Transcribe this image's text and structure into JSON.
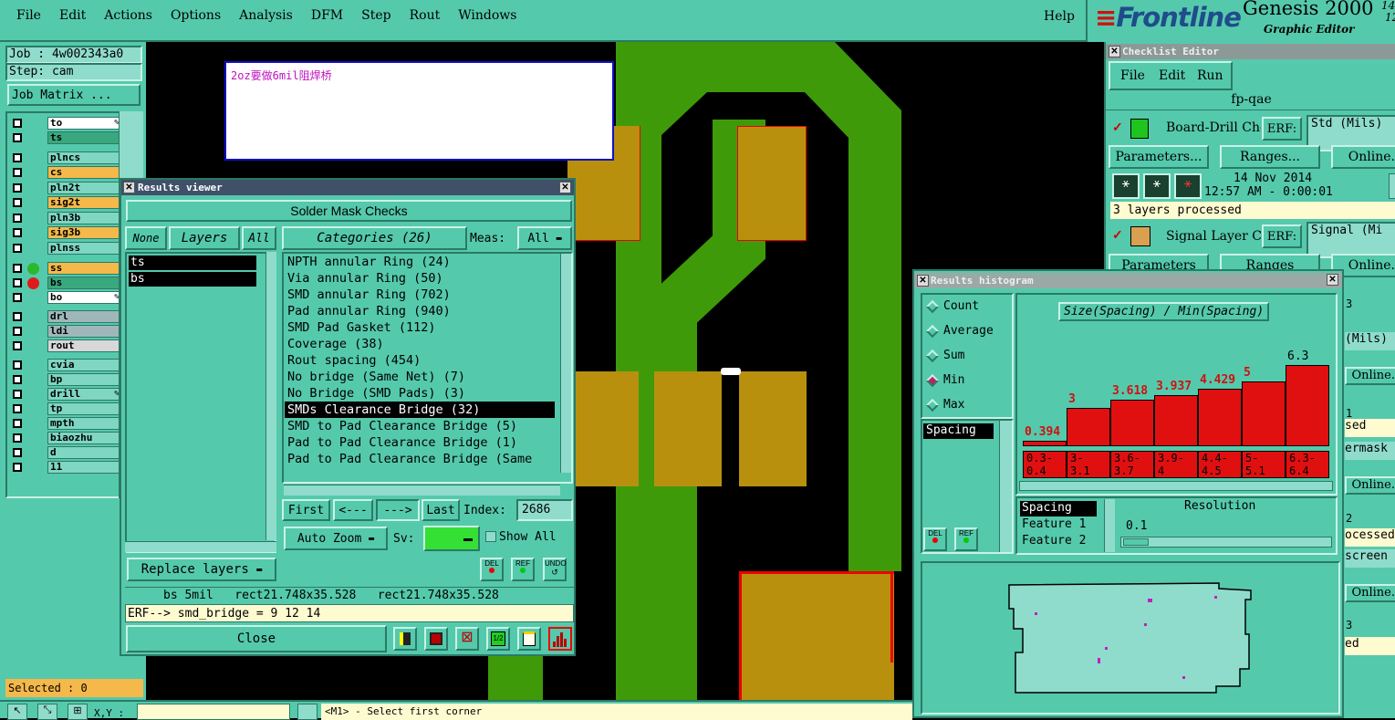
{
  "menubar": {
    "items": [
      "File",
      "Edit",
      "Actions",
      "Options",
      "Analysis",
      "DFM",
      "Step",
      "Rout",
      "Windows"
    ],
    "help": "Help"
  },
  "brand": {
    "logo": "Frontline",
    "product": "Genesis 2000",
    "subtitle": "Graphic Editor",
    "corner_top": "14",
    "corner_bottom": "12"
  },
  "left_panel": {
    "job": "Job : 4w002343a0",
    "step": "Step: cam",
    "job_matrix": "Job Matrix ...",
    "selected": "Selected : 0",
    "layers": [
      {
        "name": "to",
        "color": "#ffffff",
        "mark": true
      },
      {
        "name": "ts",
        "color": "#3aa87e",
        "mark": false
      },
      {
        "name": "plncs",
        "color": "#7fd6c2",
        "mark": false
      },
      {
        "name": "cs",
        "color": "#f5b84a",
        "mark": false
      },
      {
        "name": "pln2t",
        "color": "#7fd6c2",
        "mark": false
      },
      {
        "name": "sig2t",
        "color": "#f5b84a",
        "mark": false
      },
      {
        "name": "pln3b",
        "color": "#7fd6c2",
        "mark": false
      },
      {
        "name": "sig3b",
        "color": "#f5b84a",
        "mark": false
      },
      {
        "name": "plnss",
        "color": "#7fd6c2",
        "mark": false
      },
      {
        "name": "ss",
        "color": "#f5b84a",
        "mark": false
      },
      {
        "name": "bs",
        "color": "#3aa87e",
        "mark": false
      },
      {
        "name": "bo",
        "color": "#ffffff",
        "mark": true
      },
      {
        "name": "drl",
        "color": "#9fb7bb",
        "mark": false
      },
      {
        "name": "ldi",
        "color": "#9fb7bb",
        "mark": false
      },
      {
        "name": "rout",
        "color": "#d8d8d8",
        "mark": false
      },
      {
        "name": "cvia",
        "color": "#7fd6c2",
        "mark": false
      },
      {
        "name": "bp",
        "color": "#7fd6c2",
        "mark": false
      },
      {
        "name": "drill",
        "color": "#7fd6c2",
        "mark": true
      },
      {
        "name": "tp",
        "color": "#7fd6c2",
        "mark": false
      },
      {
        "name": "mpth",
        "color": "#7fd6c2",
        "mark": false
      },
      {
        "name": "biaozhu",
        "color": "#7fd6c2",
        "mark": false
      },
      {
        "name": "d",
        "color": "#7fd6c2",
        "mark": false
      },
      {
        "name": "11",
        "color": "#7fd6c2",
        "mark": false
      }
    ]
  },
  "note": {
    "text": "2oz要做6mil阻焊桥"
  },
  "results_viewer": {
    "title": "Results viewer",
    "heading": "Solder Mask Checks",
    "none": "None",
    "layers_label": "Layers",
    "all": "All",
    "categories_label": "Categories (26)",
    "meas_label": "Meas:",
    "meas_value": "All",
    "layer_list": [
      "ts",
      "bs"
    ],
    "categories": [
      "NPTH annular Ring (24)",
      "Via annular Ring (50)",
      "SMD annular Ring (702)",
      "Pad annular Ring (940)",
      "SMD Pad Gasket (112)",
      "Coverage (38)",
      "Rout spacing (454)",
      "No bridge (Same Net) (7)",
      "No Bridge (SMD Pads) (3)",
      "SMDs Clearance Bridge (32)",
      "SMD to Pad Clearance Bridge (5)",
      "Pad to Pad Clearance Bridge (1)",
      "Pad to Pad Clearance Bridge (Same"
    ],
    "selected_category": "SMDs Clearance Bridge (32)",
    "first": "First",
    "prev": "<---",
    "next": "--->",
    "last": "Last",
    "index_label": "Index:",
    "index_value": "2686",
    "auto_zoom": "Auto Zoom",
    "sv_label": "Sv:",
    "show_all": "Show All",
    "replace_layers": "Replace layers",
    "del": "DEL",
    "ref": "REF",
    "undo": "UNDO",
    "status": "bs 5mil   rect21.748x35.528   rect21.748x35.528",
    "erf": "ERF--> smd_bridge = 9 12 14",
    "close": "Close"
  },
  "checklist": {
    "title": "Checklist Editor",
    "menu": [
      "File",
      "Edit",
      "Run"
    ],
    "name": "fp-qae",
    "row1": {
      "label": "Board-Drill Che",
      "erf": "ERF:",
      "erf_value": "Std (Mils)",
      "parameters": "Parameters...",
      "ranges": "Ranges...",
      "online": "Online.",
      "date": "14 Nov 2014",
      "time": "12:57 AM - 0:00:01",
      "processed": "3 layers processed"
    },
    "row2": {
      "label": "Signal Layer Ch",
      "erf": "ERF:",
      "erf_value": "Signal (Mi",
      "parameters": "Parameters",
      "ranges": "Ranges",
      "online": "Online."
    },
    "partial": [
      "(Mils)",
      "Online.",
      "sed",
      "ermask",
      "Online.",
      "ocessed",
      "screen",
      "Online.",
      "ed"
    ],
    "partial_digits": [
      "3",
      "1",
      "2",
      "3"
    ]
  },
  "histogram": {
    "title": "Results histogram",
    "options": [
      "Count",
      "Average",
      "Sum",
      "Min",
      "Max"
    ],
    "selected_option": "Min",
    "chart_title": "Size(Spacing) / Min(Spacing)",
    "list": [
      "Spacing"
    ],
    "list2": [
      "Spacing",
      "Feature 1",
      "Feature 2"
    ],
    "resolution_label": "Resolution",
    "resolution_value": "0.1",
    "del": "DEL",
    "ref": "REF"
  },
  "chart_data": {
    "type": "bar",
    "title": "Size(Spacing) / Min(Spacing)",
    "categories": [
      "0.3-0.4",
      "3-3.1",
      "3.6-3.7",
      "3.9-4",
      "4.4-4.5",
      "5-5.1",
      "6.3-6.4"
    ],
    "values": [
      0.394,
      3,
      3.618,
      3.937,
      4.429,
      5,
      6.3
    ],
    "value_labels": [
      "0.394",
      "3",
      "3.618",
      "3.937",
      "4.429",
      "5",
      "6.3"
    ],
    "range_top": [
      "0.3-",
      "3-",
      "3.6-",
      "3.9-",
      "4.4-",
      "5-",
      "6.3-"
    ],
    "range_bottom": [
      "0.4",
      "3.1",
      "3.7",
      "4",
      "4.5",
      "5.1",
      "6.4"
    ],
    "bar_color": "#e01010",
    "ylim": [
      0,
      7
    ]
  },
  "bottom": {
    "xy": "X,Y :",
    "status": "<M1> - Select first corner"
  },
  "colors": {
    "panel": "#55c9ac",
    "trace": "#3f9a0a",
    "pad": "#b8900e",
    "title_bar": "#1f4c8a"
  }
}
